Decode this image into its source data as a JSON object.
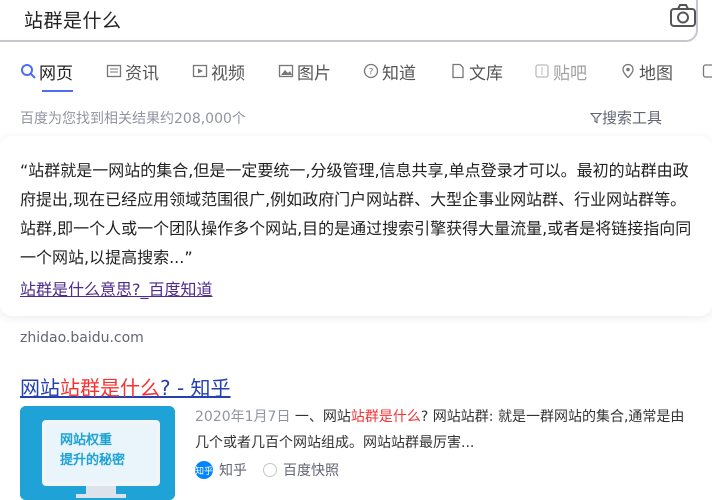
{
  "search": {
    "query": "站群是什么"
  },
  "tabs": [
    {
      "label": "网页",
      "icon": "search-icon"
    },
    {
      "label": "资讯",
      "icon": "news-icon"
    },
    {
      "label": "视频",
      "icon": "video-icon"
    },
    {
      "label": "图片",
      "icon": "image-icon"
    },
    {
      "label": "知道",
      "icon": "question-icon"
    },
    {
      "label": "文库",
      "icon": "document-icon"
    },
    {
      "label": "贴吧",
      "icon": "tieba-icon"
    },
    {
      "label": "地图",
      "icon": "map-icon"
    }
  ],
  "results_stats": "百度为您找到相关结果约208,000个",
  "search_tools": "搜索工具",
  "answer_card": {
    "text": "“站群就是一网站的集合,但是一定要统一,分级管理,信息共享,单点登录才可以。最初的站群由政府提出,现在已经应用领域范围很广,例如政府门户网站群、大型企事业网站群、行业网站群等。 站群,即一个人或一个团队操作多个网站,目的是通过搜索引擎获得大量流量,或者是将链接指向同一个网站,以提高搜索...”",
    "link": "站群是什么意思?_百度知道",
    "domain": "zhidao.baidu.com"
  },
  "result2": {
    "title_prefix": "网站",
    "title_highlight": "站群是什么",
    "title_suffix": "? - 知乎",
    "date": "2020年1月7日",
    "snippet_a": " 一、网站",
    "snippet_hl": "站群是什么",
    "snippet_b": "? 网站站群: 就是一群网站的集合,通常是由几个或者几百个网站组成。网站站群最厉害...",
    "thumb_text_1": "网站权重",
    "thumb_text_2": "提升的秘密",
    "source": "知乎",
    "cache": "百度快照"
  },
  "colors": {
    "link": "#2440b3",
    "highlight": "#f73131",
    "accent": "#4e6ef2"
  }
}
